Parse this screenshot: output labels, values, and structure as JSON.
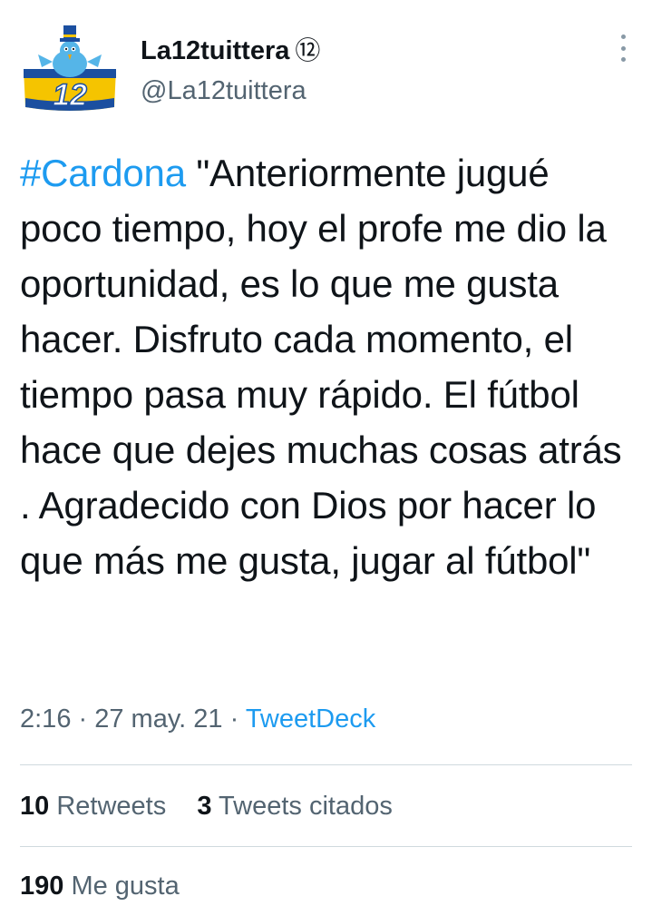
{
  "author": {
    "name": "La12tuittera",
    "badge": "⑫",
    "handle": "@La12tuittera"
  },
  "tweet": {
    "hashtag": "#Cardona",
    "text": " \"Anteriormente jugué poco tiempo, hoy el profe me dio la oportunidad, es lo que me gusta hacer. Disfruto cada momento, el tiempo pasa muy rápido. El fútbol hace que dejes muchas cosas atrás . Agradecido con Dios por hacer lo que más me gusta, jugar al fútbol\""
  },
  "meta": {
    "time": "2:16",
    "separator1": " · ",
    "date": "27 may. 21",
    "separator2": " · ",
    "source": "TweetDeck"
  },
  "stats": {
    "retweets_count": "10",
    "retweets_label": "Retweets",
    "quotes_count": "3",
    "quotes_label": "Tweets citados",
    "likes_count": "190",
    "likes_label": "Me gusta"
  },
  "icons": {
    "more": "more-vertical-icon",
    "avatar": "la12-avatar"
  },
  "colors": {
    "link": "#1d9bf0",
    "secondary_text": "#536471",
    "primary_text": "#0f1419",
    "avatar_yellow": "#f5c400",
    "avatar_blue": "#1b4fa0",
    "bird_blue": "#55b5e8"
  }
}
